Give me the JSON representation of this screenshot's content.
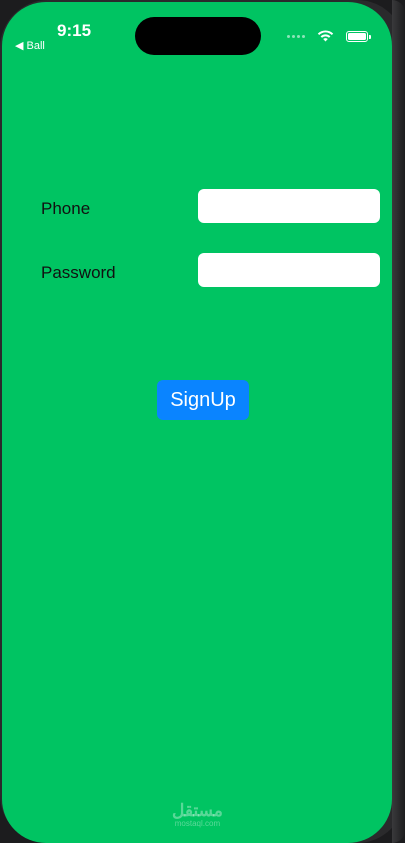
{
  "status_bar": {
    "time": "9:15",
    "back_label": "◀ Ball",
    "wifi_icon": "wifi-icon",
    "battery_icon": "battery-icon"
  },
  "form": {
    "phone_label": "Phone",
    "phone_value": "",
    "password_label": "Password",
    "password_value": "",
    "signup_label": "SignUp"
  },
  "watermark": {
    "logo": "مستقل",
    "sub": "mostaql.com"
  },
  "colors": {
    "background": "#00c462",
    "button": "#0a84ff"
  }
}
